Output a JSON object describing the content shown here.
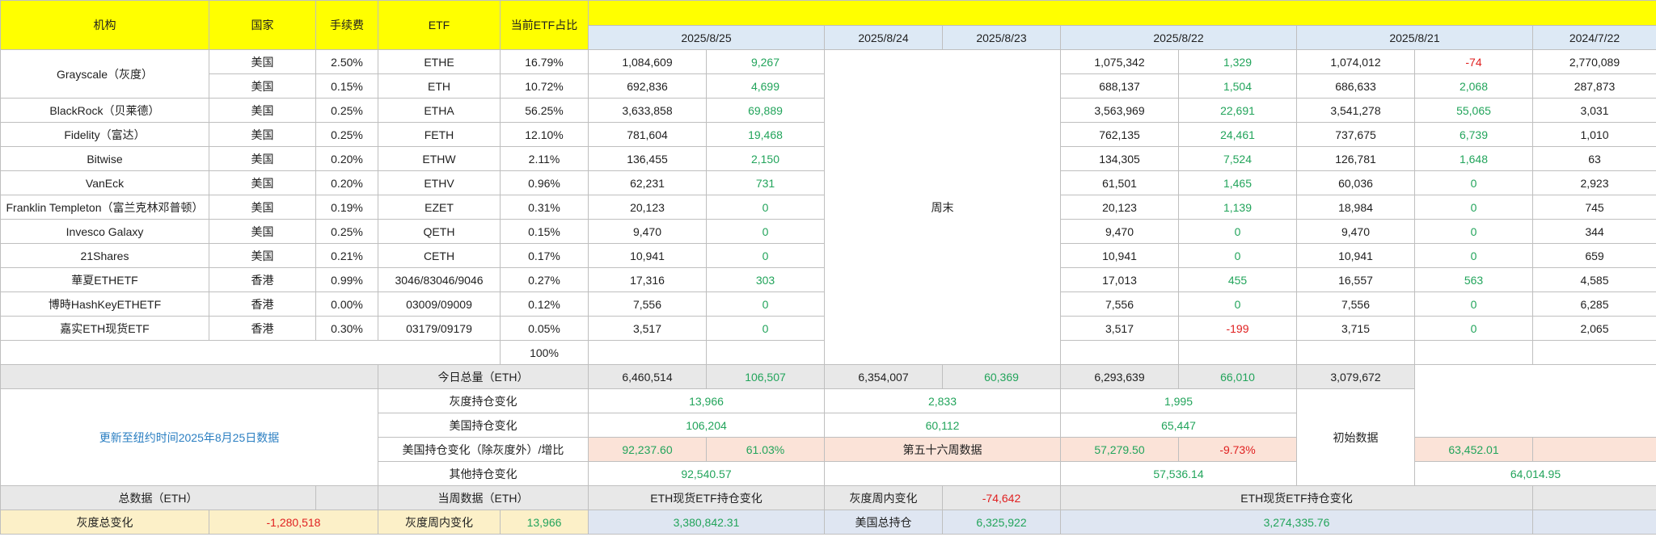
{
  "header": {
    "institution": "机构",
    "country": "国家",
    "fee": "手续费",
    "etf": "ETF",
    "share": "当前ETF占比",
    "dates": [
      "2025/8/25",
      "2025/8/24",
      "2025/8/23",
      "2025/8/22",
      "2025/8/21",
      "2024/7/22"
    ]
  },
  "weekend_label": "周末",
  "rows": [
    {
      "name": "Grayscale（灰度）",
      "country": "美国",
      "fee": "2.50%",
      "etf": "ETHE",
      "share": "16.79%",
      "d25": "1,084,609",
      "c25": "9,267",
      "d22": "1,075,342",
      "c22": "1,329",
      "d21": "1,074,012",
      "c21": "-74",
      "base": "2,770,089"
    },
    {
      "name": "",
      "country": "美国",
      "fee": "0.15%",
      "etf": "ETH",
      "share": "10.72%",
      "d25": "692,836",
      "c25": "4,699",
      "d22": "688,137",
      "c22": "1,504",
      "d21": "686,633",
      "c21": "2,068",
      "base": "287,873"
    },
    {
      "name": "BlackRock（贝莱德）",
      "country": "美国",
      "fee": "0.25%",
      "etf": "ETHA",
      "share": "56.25%",
      "d25": "3,633,858",
      "c25": "69,889",
      "d22": "3,563,969",
      "c22": "22,691",
      "d21": "3,541,278",
      "c21": "55,065",
      "base": "3,031"
    },
    {
      "name": "Fidelity（富达）",
      "country": "美国",
      "fee": "0.25%",
      "etf": "FETH",
      "share": "12.10%",
      "d25": "781,604",
      "c25": "19,468",
      "d22": "762,135",
      "c22": "24,461",
      "d21": "737,675",
      "c21": "6,739",
      "base": "1,010"
    },
    {
      "name": "Bitwise",
      "country": "美国",
      "fee": "0.20%",
      "etf": "ETHW",
      "share": "2.11%",
      "d25": "136,455",
      "c25": "2,150",
      "d22": "134,305",
      "c22": "7,524",
      "d21": "126,781",
      "c21": "1,648",
      "base": "63"
    },
    {
      "name": "VanEck",
      "country": "美国",
      "fee": "0.20%",
      "etf": "ETHV",
      "share": "0.96%",
      "d25": "62,231",
      "c25": "731",
      "d22": "61,501",
      "c22": "1,465",
      "d21": "60,036",
      "c21": "0",
      "base": "2,923"
    },
    {
      "name": "Franklin Templeton（富兰克林邓普顿）",
      "country": "美国",
      "fee": "0.19%",
      "etf": "EZET",
      "share": "0.31%",
      "d25": "20,123",
      "c25": "0",
      "d22": "20,123",
      "c22": "1,139",
      "d21": "18,984",
      "c21": "0",
      "base": "745"
    },
    {
      "name": "Invesco Galaxy",
      "country": "美国",
      "fee": "0.25%",
      "etf": "QETH",
      "share": "0.15%",
      "d25": "9,470",
      "c25": "0",
      "d22": "9,470",
      "c22": "0",
      "d21": "9,470",
      "c21": "0",
      "base": "344"
    },
    {
      "name": "21Shares",
      "country": "美国",
      "fee": "0.21%",
      "etf": "CETH",
      "share": "0.17%",
      "d25": "10,941",
      "c25": "0",
      "d22": "10,941",
      "c22": "0",
      "d21": "10,941",
      "c21": "0",
      "base": "659"
    },
    {
      "name": "華夏ETHETF",
      "country": "香港",
      "fee": "0.99%",
      "etf": "3046/83046/9046",
      "share": "0.27%",
      "d25": "17,316",
      "c25": "303",
      "d22": "17,013",
      "c22": "455",
      "d21": "16,557",
      "c21": "563",
      "base": "4,585"
    },
    {
      "name": "博時HashKeyETHETF",
      "country": "香港",
      "fee": "0.00%",
      "etf": "03009/09009",
      "share": "0.12%",
      "d25": "7,556",
      "c25": "0",
      "d22": "7,556",
      "c22": "0",
      "d21": "7,556",
      "c21": "0",
      "base": "6,285"
    },
    {
      "name": "嘉实ETH现货ETF",
      "country": "香港",
      "fee": "0.30%",
      "etf": "03179/09179",
      "share": "0.05%",
      "d25": "3,517",
      "c25": "0",
      "d22": "3,517",
      "c22": "-199",
      "d21": "3,715",
      "c21": "0",
      "base": "2,065"
    }
  ],
  "share_total": "100%",
  "summary": {
    "today_total_label": "今日总量（ETH）",
    "today_total": {
      "d25": "6,460,514",
      "c25": "106,507",
      "d22": "6,354,007",
      "c22": "60,369",
      "d21": "6,293,639",
      "c21": "66,010",
      "base": "3,079,672"
    },
    "gray_change_label": "灰度持仓变化",
    "gray_change": {
      "d25": "13,966",
      "d22": "2,833",
      "d21": "1,995"
    },
    "us_change_label": "美国持仓变化",
    "us_change": {
      "d25": "106,204",
      "d22": "60,112",
      "d21": "65,447"
    },
    "us_ex_gray_label": "美国持仓变化（除灰度外）/增比",
    "us_ex_gray": {
      "d25": "92,237.60",
      "r25": "61.03%",
      "d22": "57,279.50",
      "r22": "-9.73%",
      "d21": "63,452.01"
    },
    "week_label": "第五十六周数据",
    "other_change_label": "其他持仓变化",
    "other_change": {
      "d25": "92,540.57",
      "d22": "57,536.14",
      "d21": "64,014.95"
    },
    "update_note": "更新至纽约时间2025年8月25日数据",
    "initial_label": "初始数据"
  },
  "footer": {
    "total_label": "总数据（ETH）",
    "week_label": "当周数据（ETH）",
    "etf_change_label": "ETH现货ETF持仓变化",
    "gray_week_label": "灰度周内变化",
    "gray_week_value": "-74,642",
    "etf_change_label2": "ETH现货ETF持仓变化",
    "gray_total_label": "灰度总变化",
    "gray_total_value": "-1,280,518",
    "gray_week_label2": "灰度周内变化",
    "gray_week_value2": "13,966",
    "etf_change_value": "3,380,842.31",
    "us_total_label": "美国总持仓",
    "us_total_value": "6,325,922",
    "etf_change_value2": "3,274,335.76"
  },
  "colors": {
    "header_yellow": "#ffff00",
    "positive": "#22a45b",
    "negative": "#e02020",
    "link": "#2b7fc2"
  }
}
